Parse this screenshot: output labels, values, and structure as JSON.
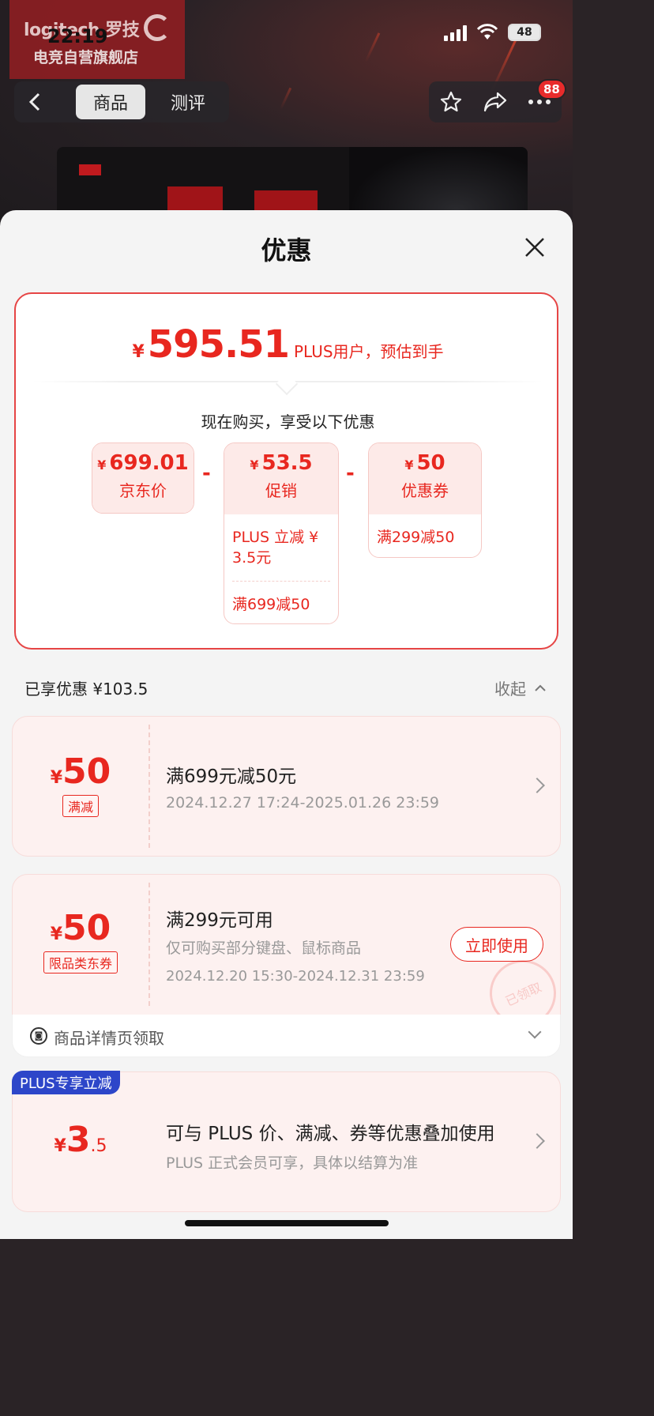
{
  "status_bar": {
    "time": "22:19",
    "battery": "48"
  },
  "brand": {
    "logo_text": "logitech 罗技",
    "store_name": "电竞自营旗舰店"
  },
  "nav": {
    "tab_product": "商品",
    "tab_review": "测评",
    "message_count": "88"
  },
  "sheet": {
    "title": "优惠"
  },
  "summary": {
    "currency": "¥",
    "final_price": "595.51",
    "final_desc": "PLUS用户，预估到手",
    "subtitle": "现在购买，享受以下优惠",
    "jd_price": {
      "value": "699.01",
      "label": "京东价"
    },
    "promo": {
      "value": "53.5",
      "label": "促销",
      "details": [
        "PLUS 立减 ¥ 3.5元",
        "满699减50"
      ]
    },
    "coupon": {
      "value": "50",
      "label": "优惠券",
      "details": [
        "满299减50"
      ]
    },
    "minus": "-"
  },
  "savings": {
    "text": "已享优惠 ¥103.5",
    "collapse_label": "收起"
  },
  "coupons": [
    {
      "amount": "50",
      "tag": "满减",
      "title": "满699元减50元",
      "date": "2024.12.27 17:24-2025.01.26 23:59"
    },
    {
      "amount": "50",
      "tag": "限品类东券",
      "title": "满299元可用",
      "desc": "仅可购买部分键盘、鼠标商品",
      "date": "2024.12.20 15:30-2024.12.31 23:59",
      "button": "立即使用",
      "stamp": "已领取"
    }
  ],
  "coupon_source": "商品详情页领取",
  "plus": {
    "badge": "PLUS专享立减",
    "amount_int": "3",
    "amount_dec": ".5",
    "title": "可与 PLUS 价、满减、券等优惠叠加使用",
    "desc": "PLUS 正式会员可享，具体以结算为准"
  },
  "colors": {
    "accent": "#e8271f",
    "plus_blue": "#2d46c9"
  }
}
